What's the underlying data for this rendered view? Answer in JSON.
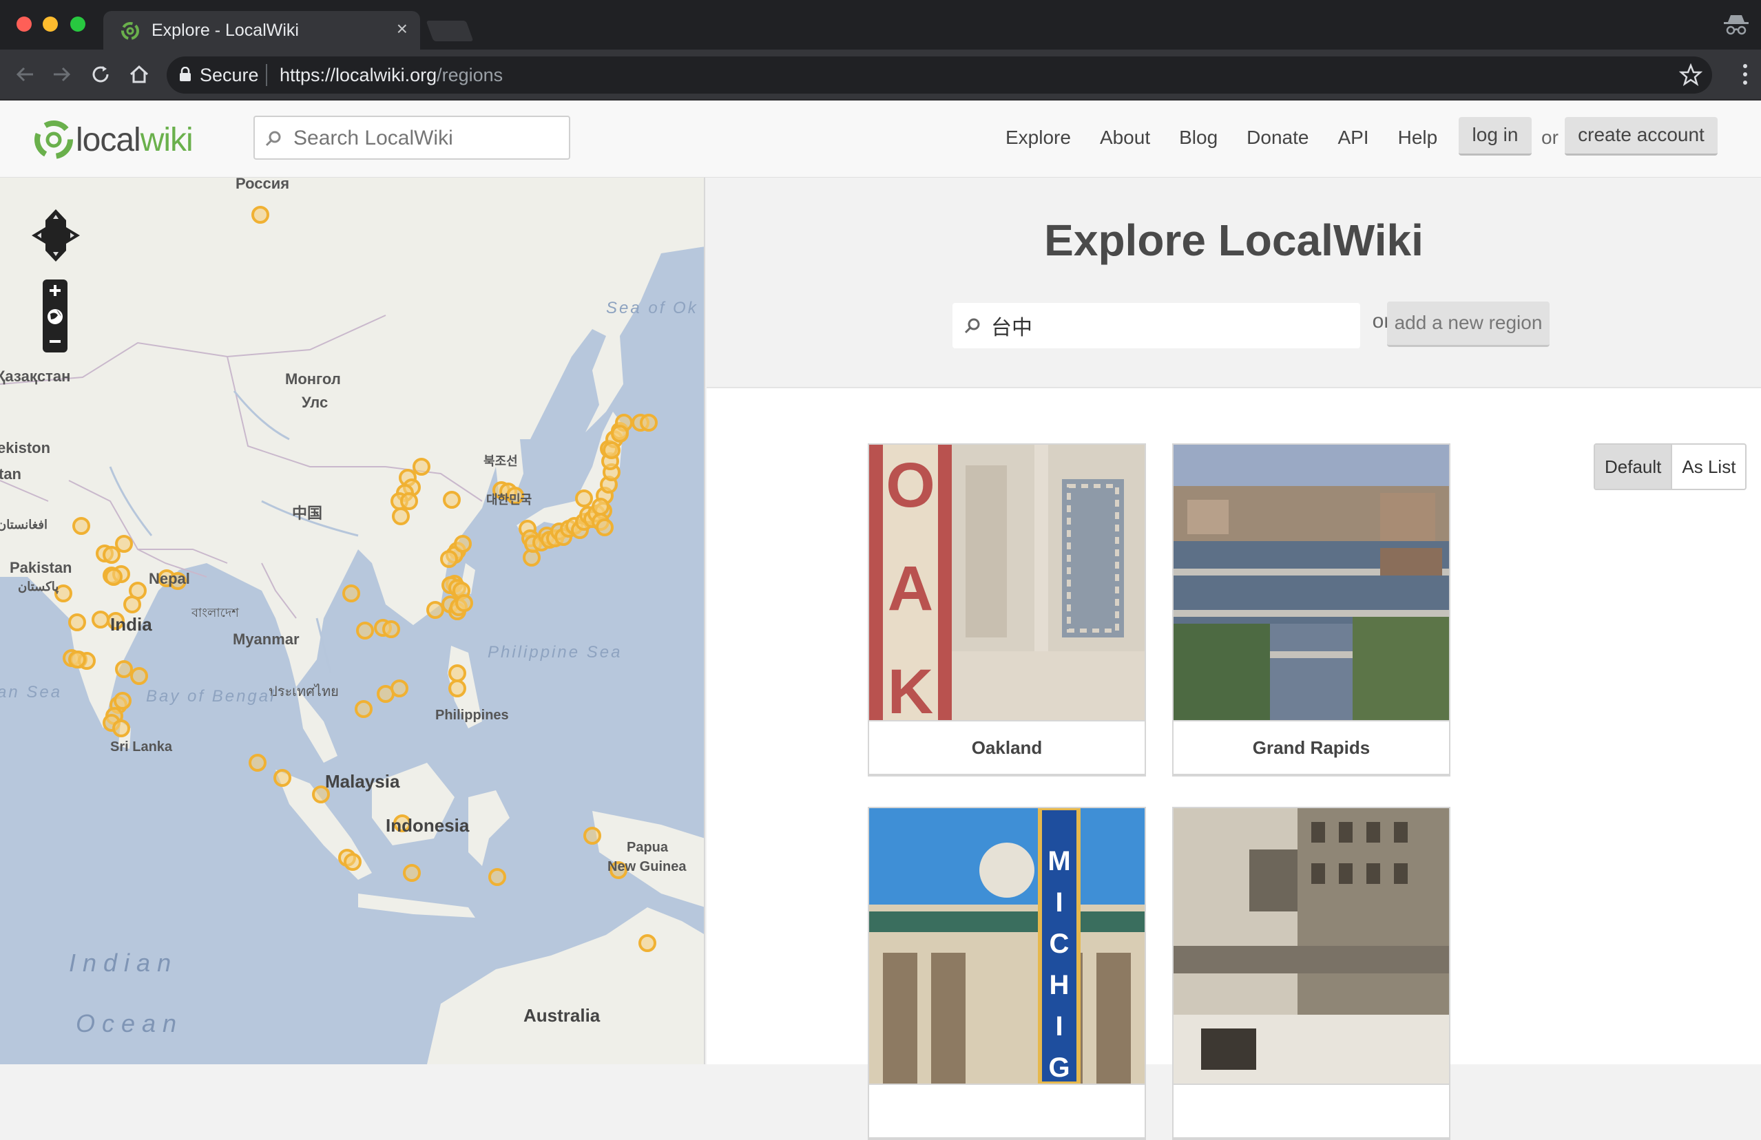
{
  "browser": {
    "tab_title": "Explore - LocalWiki",
    "tab_close": "×",
    "secure_label": "Secure",
    "url_base": "https://localwiki.org",
    "url_path": "/regions"
  },
  "header": {
    "logo_local": "local",
    "logo_wiki": "wiki",
    "search_placeholder": "Search LocalWiki",
    "nav": [
      "Explore",
      "About",
      "Blog",
      "Donate",
      "API",
      "Help"
    ],
    "login": "log in",
    "or": "or",
    "create_account": "create account"
  },
  "map": {
    "labels": [
      {
        "text": "Россия"
      },
      {
        "text": "Қазақстан"
      },
      {
        "text": "Монгол"
      },
      {
        "text": "Улс"
      },
      {
        "text": "ekiston"
      },
      {
        "text": "tan"
      },
      {
        "text": "中国"
      },
      {
        "text": "북조선"
      },
      {
        "text": "대한민국"
      },
      {
        "text": "افغانستان"
      },
      {
        "text": "Pakistan"
      },
      {
        "text": "پاکستان"
      },
      {
        "text": "Nepal"
      },
      {
        "text": "India"
      },
      {
        "text": "বাংলাদেশ"
      },
      {
        "text": "Myanmar"
      },
      {
        "text": "ประเทศไทย"
      },
      {
        "text": "Philippines"
      },
      {
        "text": "Sri Lanka"
      },
      {
        "text": "Malaysia"
      },
      {
        "text": "Indonesia"
      },
      {
        "text": "Papua"
      },
      {
        "text": "New Guinea"
      },
      {
        "text": "Australia"
      }
    ],
    "seas": [
      {
        "text": "Philippine Sea"
      },
      {
        "text": "Bay of Bengal"
      },
      {
        "text": "an Sea"
      },
      {
        "text": "Sea of Ok"
      },
      {
        "text": "Indian"
      },
      {
        "text": "Ocean"
      }
    ],
    "marker_color": "#f0b133"
  },
  "explore": {
    "title": "Explore LocalWiki",
    "region_search_value": "台中",
    "or": "or",
    "add_region": "add a new region",
    "view_default": "Default",
    "view_list": "As List",
    "regions": [
      {
        "name": "Oakland"
      },
      {
        "name": "Grand Rapids"
      },
      {
        "name": ""
      },
      {
        "name": ""
      }
    ]
  }
}
